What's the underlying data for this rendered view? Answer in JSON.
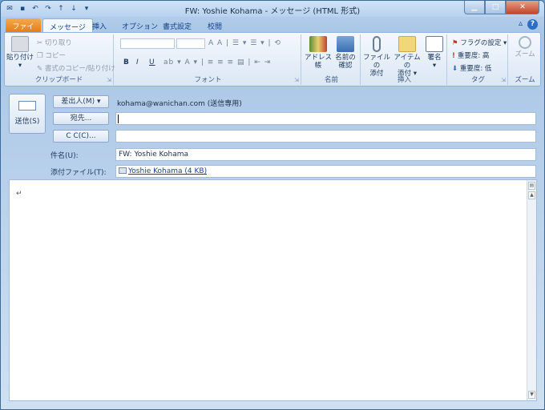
{
  "window": {
    "title": "FW: Yoshie Kohama - メッセージ (HTML 形式)"
  },
  "tabs": [
    "ファイル",
    "メッセージ",
    "挿入",
    "オプション",
    "書式設定",
    "校閲"
  ],
  "clipboard": {
    "paste": "貼り付け",
    "cut": "切り取り",
    "copy": "コピー",
    "format_copy": "書式のコピー/貼り付け",
    "group": "クリップボード"
  },
  "font": {
    "group": "フォント",
    "bold": "B",
    "italic": "I",
    "underline": "U"
  },
  "names": {
    "address_book": "アドレス帳",
    "check_names_1": "名前の",
    "check_names_2": "確認",
    "group": "名前"
  },
  "insert": {
    "attach_file_1": "ファイルの",
    "attach_file_2": "添付",
    "attach_item_1": "アイテムの",
    "attach_item_2": "添付 ▾",
    "signature": "署名",
    "group": "挿入"
  },
  "tags": {
    "flag": "フラグの設定 ▾",
    "high": "重要度: 高",
    "low": "重要度: 低",
    "group": "タグ"
  },
  "zoom": {
    "button": "ズーム",
    "group": "ズーム"
  },
  "compose": {
    "send": "送信(S)",
    "from_button": "差出人(M) ▾",
    "from_value": "kohama@wanichan.com (送信専用)",
    "to_button": "宛先...",
    "to_value": "",
    "cc_button": "C C(C)...",
    "cc_value": "",
    "subject_label": "件名(U):",
    "subject_value": "FW: Yoshie Kohama",
    "attach_label": "添付ファイル(T):",
    "attach_value": "Yoshie Kohama (4 KB)"
  },
  "body": {
    "paragraph_mark": "↵"
  }
}
